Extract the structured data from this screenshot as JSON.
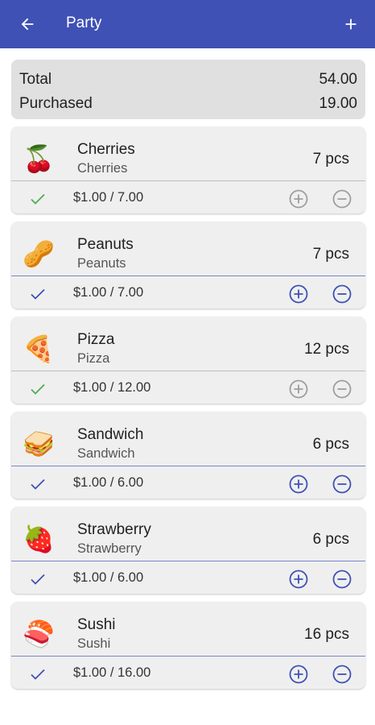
{
  "appbar": {
    "title": "Party",
    "back_icon": "arrow-back-icon",
    "add_icon": "plus-icon"
  },
  "summary": {
    "total_label": "Total",
    "total_value": "54.00",
    "purchased_label": "Purchased",
    "purchased_value": "19.00"
  },
  "colors": {
    "primary": "#3f51b5",
    "check_green": "#4caf50",
    "check_blue": "#3f51b5",
    "disabled": "#9e9e9e"
  },
  "items": [
    {
      "emoji": "🍒",
      "icon": "cherries-icon",
      "name": "Cherries",
      "sub": "Cherries",
      "qty": "7 pcs",
      "price": "$1.00 / 7.00",
      "purchased": true
    },
    {
      "emoji": "🥜",
      "icon": "peanuts-icon",
      "name": "Peanuts",
      "sub": "Peanuts",
      "qty": "7 pcs",
      "price": "$1.00 / 7.00",
      "purchased": false
    },
    {
      "emoji": "🍕",
      "icon": "pizza-icon",
      "name": "Pizza",
      "sub": "Pizza",
      "qty": "12 pcs",
      "price": "$1.00 / 12.00",
      "purchased": true
    },
    {
      "emoji": "🥪",
      "icon": "sandwich-icon",
      "name": "Sandwich",
      "sub": "Sandwich",
      "qty": "6 pcs",
      "price": "$1.00 / 6.00",
      "purchased": false
    },
    {
      "emoji": "🍓",
      "icon": "strawberry-icon",
      "name": "Strawberry",
      "sub": "Strawberry",
      "qty": "6 pcs",
      "price": "$1.00 / 6.00",
      "purchased": false
    },
    {
      "emoji": "🍣",
      "icon": "sushi-icon",
      "name": "Sushi",
      "sub": "Sushi",
      "qty": "16 pcs",
      "price": "$1.00 / 16.00",
      "purchased": false
    }
  ]
}
